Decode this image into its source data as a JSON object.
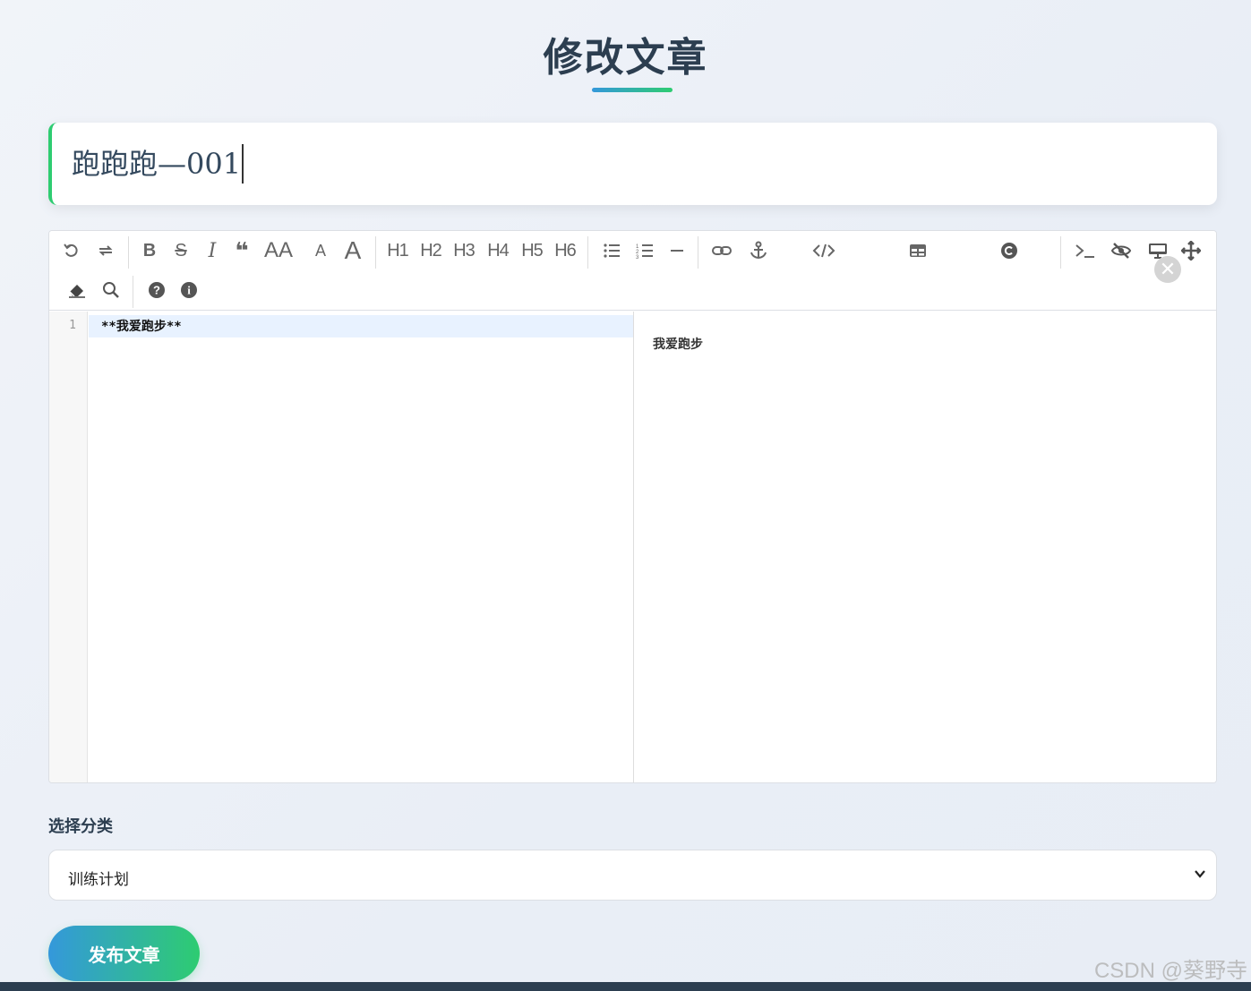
{
  "page": {
    "title": "修改文章"
  },
  "article": {
    "title_value": "跑跑跑—001"
  },
  "toolbar": {
    "headings": [
      "H1",
      "H2",
      "H3",
      "H4",
      "H5",
      "H6"
    ],
    "font_size_large": "AA",
    "font_size_small": "A",
    "font_size_capital": "A"
  },
  "editor": {
    "line_numbers": [
      "1"
    ],
    "code_lines": [
      "**我爱跑步**"
    ],
    "preview_text": "我爱跑步"
  },
  "category": {
    "label": "选择分类",
    "selected": "训练计划"
  },
  "actions": {
    "publish_label": "发布文章"
  },
  "watermark": "CSDN @葵野寺",
  "colors": {
    "accent_blue": "#3498db",
    "accent_green": "#2ecc71",
    "dark": "#2c3e50"
  }
}
